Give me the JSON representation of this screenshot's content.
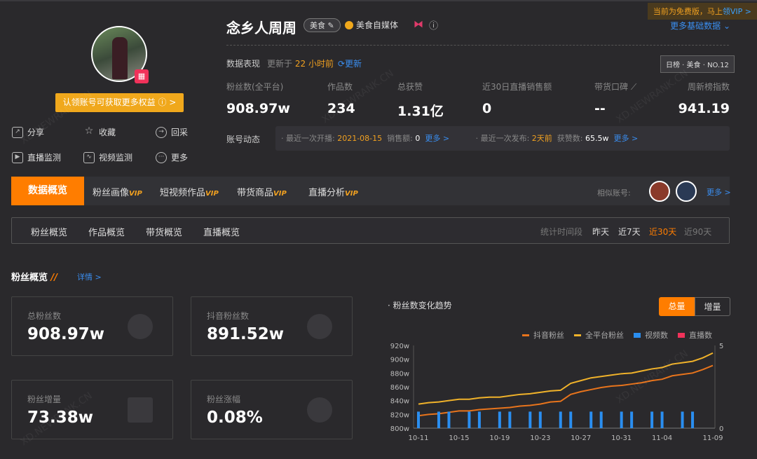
{
  "vip_tip": {
    "text": "当前为免费版，马上",
    "link": "领VIP >"
  },
  "profile": {
    "name": "念乡人周周",
    "tag": "美食",
    "verify": "美食自媒体",
    "claim_button": "认领账号可获取更多权益 ⓘ >",
    "more_basic": "更多基础数据 ⌄"
  },
  "actions": [
    {
      "label": "分享",
      "icon": "share-icon"
    },
    {
      "label": "收藏",
      "icon": "star-icon"
    },
    {
      "label": "回采",
      "icon": "recollect-icon"
    },
    {
      "label": "直播监测",
      "icon": "live-monitor-icon"
    },
    {
      "label": "视频监测",
      "icon": "video-monitor-icon"
    },
    {
      "label": "更多",
      "icon": "more-icon"
    }
  ],
  "performance": {
    "label": "数据表现",
    "updated_prefix": "更新于",
    "updated_value": "22 小时前",
    "refresh": "⟳更新",
    "rank": "日榜 · 美食 · NO.12"
  },
  "stats": [
    {
      "label": "粉丝数(全平台)",
      "value": "908.97w"
    },
    {
      "label": "作品数",
      "value": "234"
    },
    {
      "label": "总获赞",
      "value": "1.31亿"
    },
    {
      "label": "近30日直播销售额",
      "value": "0"
    },
    {
      "label": "带货口碑",
      "value": "--"
    },
    {
      "label": "周新榜指数",
      "value": "941.19"
    }
  ],
  "dynamics": {
    "label": "账号动态",
    "live_prefix": "· 最近一次开播:",
    "live_date": "2021-08-15",
    "sales_label": "销售额:",
    "sales_value": "0",
    "more1": "更多 >",
    "post_prefix": "· 最近一次发布:",
    "post_value": "2天前",
    "likes_label": "获赞数:",
    "likes_value": "65.5w",
    "more2": "更多 >"
  },
  "tabs": [
    {
      "label": "数据概览"
    },
    {
      "label": "粉丝画像",
      "vip": "VIP"
    },
    {
      "label": "短视频作品",
      "vip": "VIP"
    },
    {
      "label": "带货商品",
      "vip": "VIP"
    },
    {
      "label": "直播分析",
      "vip": "VIP"
    }
  ],
  "similar": {
    "label": "相似账号:",
    "more": "更多 >"
  },
  "subtabs": [
    "粉丝概览",
    "作品概览",
    "带货概览",
    "直播概览"
  ],
  "period": {
    "label": "统计时间段",
    "options": [
      "昨天",
      "近7天",
      "近30天",
      "近90天"
    ],
    "selected": "近30天"
  },
  "section": {
    "title": "粉丝概览",
    "detail": "详情 >"
  },
  "cards": [
    {
      "label": "总粉丝数",
      "value": "908.97w"
    },
    {
      "label": "抖音粉丝数",
      "value": "891.52w"
    },
    {
      "label": "粉丝增量",
      "value": "73.38w"
    },
    {
      "label": "粉丝涨幅",
      "value": "0.08%"
    }
  ],
  "chart_toggle": {
    "total": "总量",
    "increment": "增量"
  },
  "colors": {
    "accent": "#ff7d00",
    "douyin": "#e8741c",
    "all": "#f0b22a",
    "video": "#2a8ef0",
    "live": "#f0325a"
  },
  "chart_data": {
    "type": "line",
    "title": "· 粉丝数变化趋势",
    "x": [
      "10-11",
      "10-12",
      "10-13",
      "10-14",
      "10-15",
      "10-16",
      "10-17",
      "10-18",
      "10-19",
      "10-20",
      "10-21",
      "10-22",
      "10-23",
      "10-24",
      "10-25",
      "10-26",
      "10-27",
      "10-28",
      "10-29",
      "10-30",
      "10-31",
      "11-01",
      "11-02",
      "11-03",
      "11-04",
      "11-05",
      "11-06",
      "11-07",
      "11-08",
      "11-09"
    ],
    "xticks": [
      "10-11",
      "10-15",
      "10-19",
      "10-23",
      "10-27",
      "10-31",
      "11-04",
      "11-09"
    ],
    "yticks": [
      "800w",
      "820w",
      "840w",
      "860w",
      "880w",
      "900w",
      "920w"
    ],
    "ylim": [
      800,
      920
    ],
    "y2ticks": [
      "0",
      "5"
    ],
    "y2lim": [
      0,
      5
    ],
    "series": [
      {
        "name": "抖音粉丝",
        "type": "line",
        "values": [
          818,
          820,
          821,
          823,
          825,
          825,
          827,
          828,
          829,
          830,
          832,
          833,
          835,
          838,
          839,
          849,
          853,
          856,
          859,
          861,
          862,
          864,
          866,
          869,
          871,
          876,
          878,
          880,
          885,
          891
        ]
      },
      {
        "name": "全平台粉丝",
        "type": "line",
        "values": [
          835,
          837,
          838,
          840,
          842,
          842,
          844,
          845,
          845,
          847,
          849,
          850,
          852,
          854,
          855,
          865,
          869,
          873,
          875,
          877,
          879,
          880,
          883,
          886,
          888,
          893,
          895,
          897,
          902,
          909
        ]
      },
      {
        "name": "视频数",
        "type": "bar",
        "axis": "right",
        "values": [
          1,
          0,
          1,
          1,
          0,
          1,
          1,
          0,
          1,
          1,
          0,
          1,
          1,
          0,
          1,
          1,
          0,
          1,
          1,
          0,
          1,
          1,
          0,
          1,
          1,
          0,
          1,
          1,
          0,
          0
        ]
      },
      {
        "name": "直播数",
        "type": "bar",
        "axis": "right",
        "values": [
          0,
          0,
          0,
          0,
          0,
          0,
          0,
          0,
          0,
          0,
          0,
          0,
          0,
          0,
          0,
          0,
          0,
          0,
          0,
          0,
          0,
          0,
          0,
          0,
          0,
          0,
          0,
          0,
          0,
          0
        ]
      }
    ]
  }
}
